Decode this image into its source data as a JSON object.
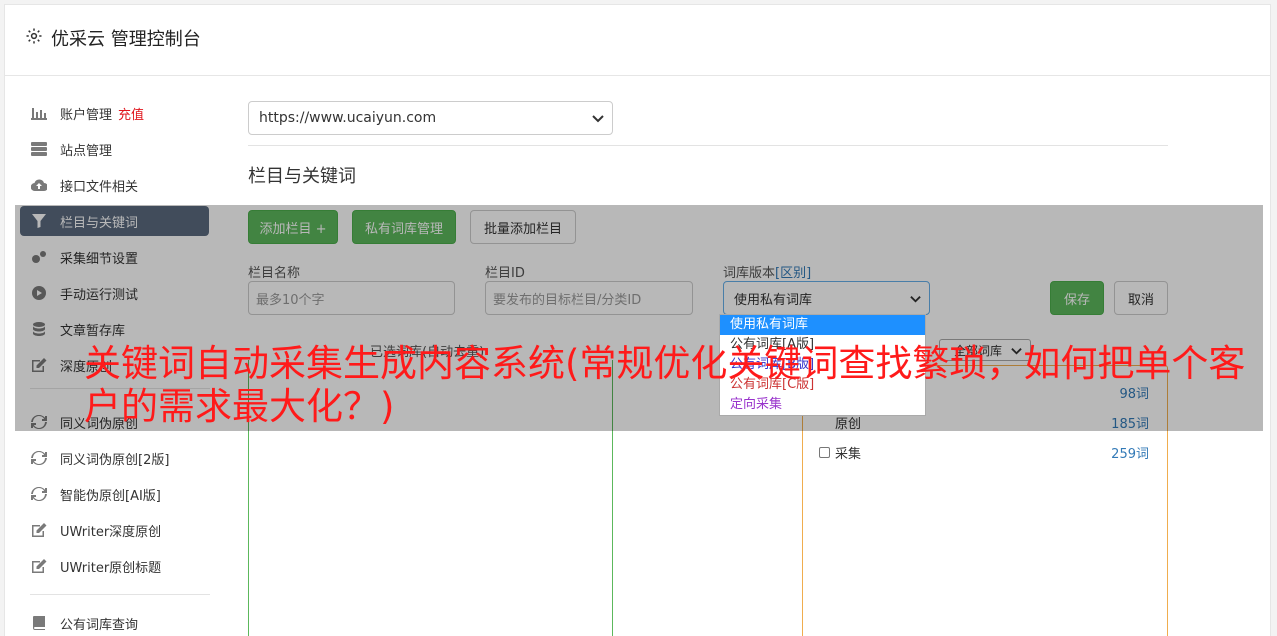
{
  "app": {
    "title": "优采云 管理控制台"
  },
  "sidebar": {
    "items": [
      {
        "label": "账户管理",
        "badge": "充值",
        "icon": "bar-chart-icon"
      },
      {
        "label": "站点管理",
        "icon": "server-icon"
      },
      {
        "label": "接口文件相关",
        "icon": "cloud-upload-icon"
      },
      {
        "label": "栏目与关键词",
        "icon": "filter-icon"
      },
      {
        "label": "采集细节设置",
        "icon": "cogs-icon"
      },
      {
        "label": "手动运行测试",
        "icon": "play-circle-icon"
      },
      {
        "label": "文章暂存库",
        "icon": "database-icon"
      },
      {
        "label": "深度原创",
        "icon": "edit-icon"
      },
      {
        "label": "同义词伪原创",
        "icon": "refresh-icon"
      },
      {
        "label": "同义词伪原创[2版]",
        "icon": "refresh-icon"
      },
      {
        "label": "智能伪原创[AI版]",
        "icon": "refresh-icon"
      },
      {
        "label": "UWriter深度原创",
        "icon": "edit-icon"
      },
      {
        "label": "UWriter原创标题",
        "icon": "edit-icon"
      },
      {
        "label": "公有词库查询",
        "icon": "book-icon"
      }
    ]
  },
  "main": {
    "site_select": "https://www.ucaiyun.com",
    "section_title": "栏目与关键词",
    "buttons": {
      "add_column": "添加栏目 +",
      "private_lib": "私有词库管理",
      "batch_add": "批量添加栏目",
      "save": "保存",
      "cancel": "取消"
    },
    "form": {
      "column_name_label": "栏目名称",
      "column_name_placeholder": "最多10个字",
      "column_id_label": "栏目ID",
      "column_id_placeholder": "要发布的目标栏目/分类ID",
      "lib_version_label": "词库版本",
      "lib_version_link": "[区别]",
      "lib_version_value": "使用私有词库"
    },
    "dropdown_options": [
      {
        "label": "使用私有词库",
        "color": "#ffffff",
        "selected": true
      },
      {
        "label": "公有词库[A版]",
        "color": "#333333"
      },
      {
        "label": "公有词库[B版]",
        "color": "#3333cc"
      },
      {
        "label": "公有词库[C版]",
        "color": "#cc3333"
      },
      {
        "label": "定向采集",
        "color": "#9933cc"
      }
    ],
    "selected_libs_label": "已选词库(自动去重)",
    "filter_select": "全部词库",
    "libraries": [
      {
        "name": "",
        "count": "98词"
      },
      {
        "name": "原创",
        "count": "185词"
      },
      {
        "name": "采集",
        "count": "259词"
      }
    ]
  },
  "headline": "关键词自动采集生成内容系统(常规优化关键词查找繁琐，如何把单个客户的需求最大化？)",
  "colors": {
    "green": "#5cb85c",
    "blue": "#337ab7",
    "active": "#5a6a7e",
    "red": "#ff1a1a"
  }
}
